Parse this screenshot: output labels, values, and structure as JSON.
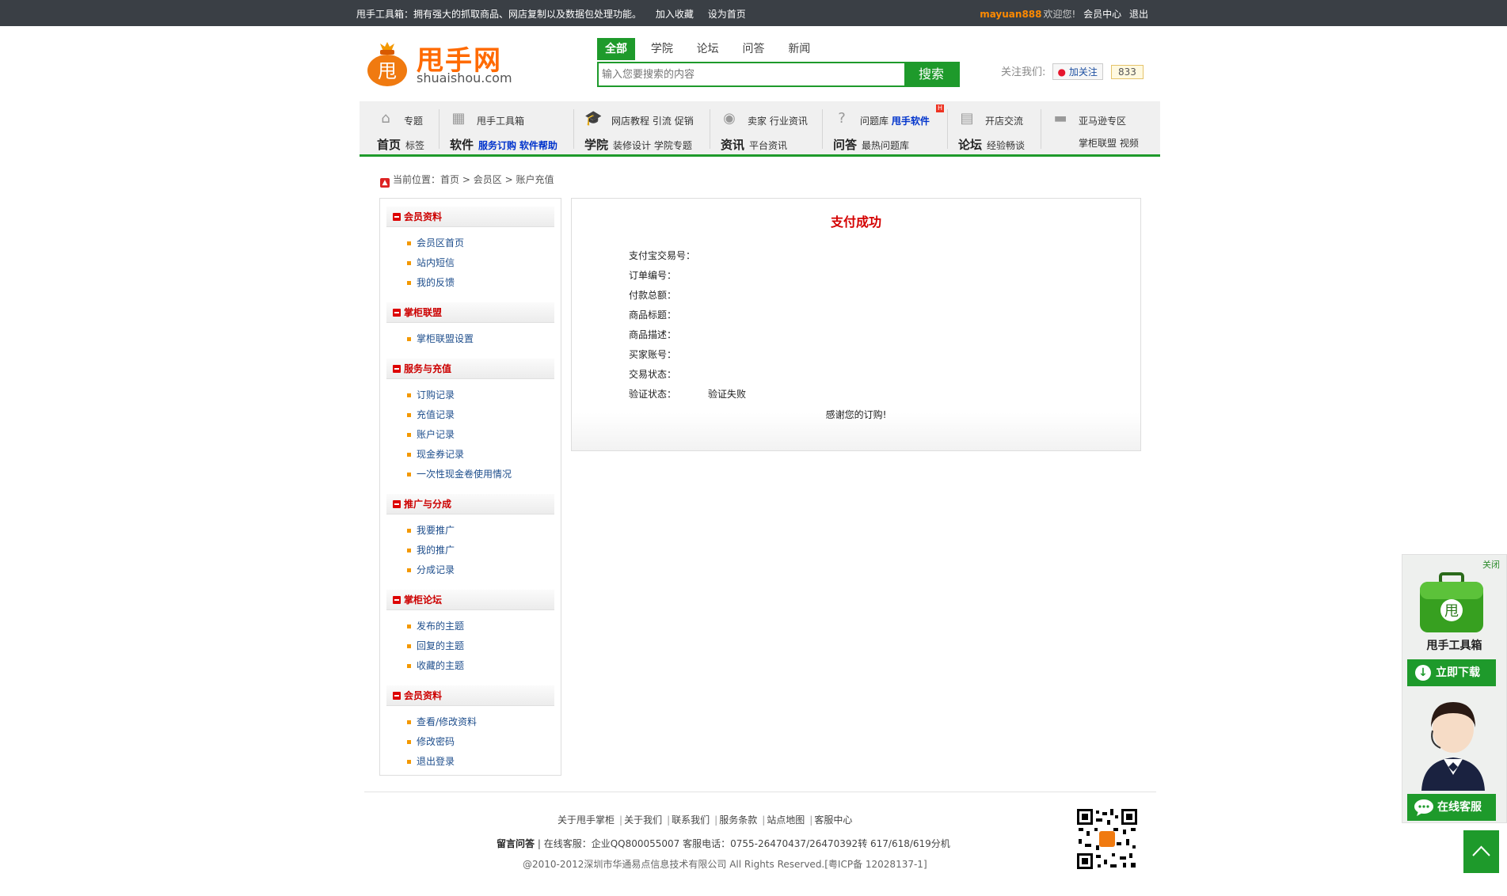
{
  "topbar": {
    "intro": "甩手工具箱：拥有强大的抓取商品、网店复制以及数据包处理功能。",
    "bookmark": "加入收藏",
    "homepage": "设为首页",
    "username": "mayuan888",
    "welcome": "欢迎您!",
    "member_center": "会员中心",
    "logout": "退出"
  },
  "logo": {
    "cn": "甩手网",
    "en": "shuaishou.com",
    "bag_glyph": "甩"
  },
  "search": {
    "tabs": [
      "全部",
      "学院",
      "论坛",
      "问答",
      "新闻"
    ],
    "placeholder": "输入您要搜索的内容",
    "button": "搜索"
  },
  "follow": {
    "label": "关注我们:",
    "weibo": "加关注",
    "count": "833"
  },
  "nav": {
    "home": {
      "row1": "专题",
      "big": "首页",
      "row2": "标签",
      "icon": "home-icon"
    },
    "software": {
      "row1": "甩手工具箱",
      "big": "软件",
      "row2a": "服务订购",
      "row2b": "软件帮助",
      "icon": "grid-icon"
    },
    "academy": {
      "row1a": "网店教程",
      "row1b": "引流",
      "row1c": "促销",
      "big": "学院",
      "row2a": "装修设计",
      "row2b": "学院专题",
      "icon": "graduation-cap-icon"
    },
    "news": {
      "row1a": "卖家",
      "row1b": "行业资讯",
      "big": "资讯",
      "row2": "平台资讯",
      "icon": "rss-icon"
    },
    "qa": {
      "row1a": "问题库",
      "row1b": "甩手软件",
      "big": "问答",
      "row2": "最热问题库",
      "hot": "H",
      "icon": "question-icon"
    },
    "forum": {
      "row1": "开店交流",
      "big": "论坛",
      "row2": "经验畅谈",
      "icon": "chat-icon"
    },
    "amazon": {
      "row1": "亚马逊专区",
      "row2a": "掌柜联盟",
      "row2b": "视频",
      "icon": "truck-icon"
    }
  },
  "breadcrumb": {
    "prefix": "当前位置：",
    "items": [
      "首页",
      "会员区",
      "账户充值"
    ],
    "sep": ">"
  },
  "sidebar": {
    "groups": [
      {
        "title": "会员资料",
        "items": [
          "会员区首页",
          "站内短信",
          "我的反馈"
        ]
      },
      {
        "title": "掌柜联盟",
        "items": [
          "掌柜联盟设置"
        ]
      },
      {
        "title": "服务与充值",
        "items": [
          "订购记录",
          "充值记录",
          "账户记录",
          "现金券记录",
          "一次性现金卷使用情况"
        ]
      },
      {
        "title": "推广与分成",
        "items": [
          "我要推广",
          "我的推广",
          "分成记录"
        ]
      },
      {
        "title": "掌柜论坛",
        "items": [
          "发布的主题",
          "回复的主题",
          "收藏的主题"
        ]
      },
      {
        "title": "会员资料",
        "items": [
          "查看/修改资料",
          "修改密码",
          "退出登录"
        ]
      }
    ]
  },
  "panel": {
    "title": "支付成功",
    "rows": [
      {
        "label": "支付宝交易号：",
        "value": ""
      },
      {
        "label": "订单编号：",
        "value": ""
      },
      {
        "label": "付款总额：",
        "value": ""
      },
      {
        "label": "商品标题：",
        "value": ""
      },
      {
        "label": "商品描述：",
        "value": ""
      },
      {
        "label": "买家账号：",
        "value": ""
      },
      {
        "label": "交易状态：",
        "value": ""
      },
      {
        "label": "验证状态：",
        "value": "验证失败"
      }
    ],
    "thanks": "感谢您的订购!"
  },
  "footer": {
    "links": [
      "关于甩手掌柜",
      "关于我们",
      "联系我们",
      "服务条款",
      "站点地图",
      "客服中心"
    ],
    "contact_bold": "留言问答",
    "contact": "| 在线客服：企业QQ800055007 客服电话：0755-26470437/26470392转 617/618/619分机",
    "copyright": "@2010-2012深圳市华通易点信息技术有限公司 All Rights Reserved.[粤ICP备 12028137-1]"
  },
  "float": {
    "close": "关闭",
    "title": "甩手工具箱",
    "download": "立即下载",
    "chat": "在线客服"
  },
  "colors": {
    "brand_green": "#1e9a2b",
    "brand_orange": "#ff6a00",
    "alert_red": "#d40000",
    "topbar_bg": "#3a3f45",
    "link_blue": "#1e4e8c"
  }
}
